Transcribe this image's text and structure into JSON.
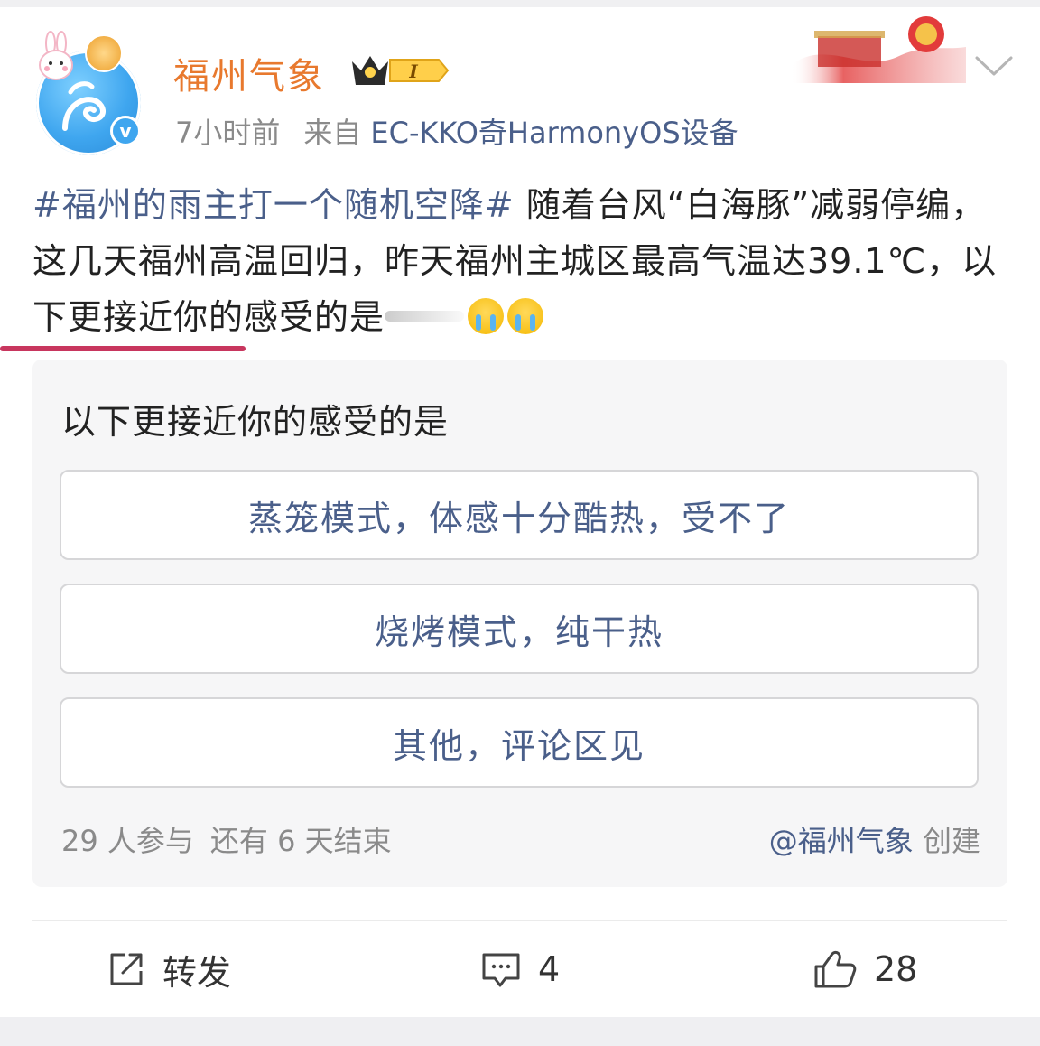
{
  "header": {
    "username": "福州气象",
    "timestamp": "7小时前",
    "source_prefix": "来自",
    "source_device": "EC-KKO奇HarmonyOS设备",
    "badge_level": "I",
    "verified_mark": "v"
  },
  "post": {
    "hashtag": "#福州的雨主打一个随机空降#",
    "text": " 随着台风“白海豚”减弱停编，这几天福州高温回归，昨天福州主城区最高气温达39.1℃，以下更接近你的感受的是"
  },
  "poll": {
    "title": "以下更接近你的感受的是",
    "options": [
      {
        "label": "蒸笼模式，体感十分酷热，受不了"
      },
      {
        "label": "烧烤模式，纯干热"
      },
      {
        "label": "其他，评论区见"
      }
    ],
    "participants": "29 人参与",
    "remaining": "还有 6 天结束",
    "creator_name": "@福州气象",
    "creator_suffix": "创建"
  },
  "actions": {
    "repost_label": "转发",
    "comment_count": "4",
    "like_count": "28"
  },
  "colors": {
    "username": "#e8792e",
    "link": "#4a5f8a",
    "accent_line": "#c8365e"
  },
  "icons": [
    "rabbit-icon",
    "mooncake-icon",
    "verified-icon",
    "crown-badge-icon",
    "chevron-down-icon",
    "crying-emoji-icon",
    "repost-icon",
    "comment-icon",
    "like-icon"
  ]
}
